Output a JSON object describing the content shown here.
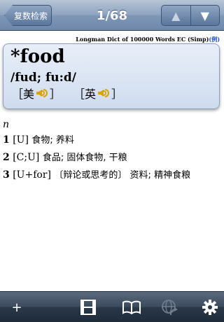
{
  "navbar": {
    "back_label": "复数检索",
    "title": "1/68",
    "prev_icon": "triangle-up-icon",
    "next_icon": "triangle-down-icon"
  },
  "dictionary": {
    "source": "Longman Dict of 100000 Words EC (Simp)",
    "example_link": "(例)"
  },
  "entry": {
    "headword": "*food",
    "phonetic": "/fud; fu:d/",
    "audio": [
      {
        "label": "美",
        "icon": "speaker-icon"
      },
      {
        "label": "英",
        "icon": "speaker-icon"
      }
    ]
  },
  "definitions": {
    "part_of_speech": "n",
    "senses": [
      {
        "num": "1",
        "grammar": "[U]",
        "text": "食物; 养料"
      },
      {
        "num": "2",
        "grammar": "[C;U]",
        "text": "食品; 固体食物, 干粮"
      },
      {
        "num": "3",
        "grammar": "[U+for]",
        "text": "〔辩论或思考的〕 资料; 精神食粮"
      }
    ]
  },
  "toolbar": {
    "add_label": "+",
    "items": [
      "plus-icon",
      "film-icon",
      "book-icon",
      "globe-icon",
      "gear-icon"
    ]
  },
  "colors": {
    "accent": "#6e88aa",
    "card_bg": "#dbe5f3",
    "speaker": "#d9a400",
    "link": "#1a4fd0"
  }
}
